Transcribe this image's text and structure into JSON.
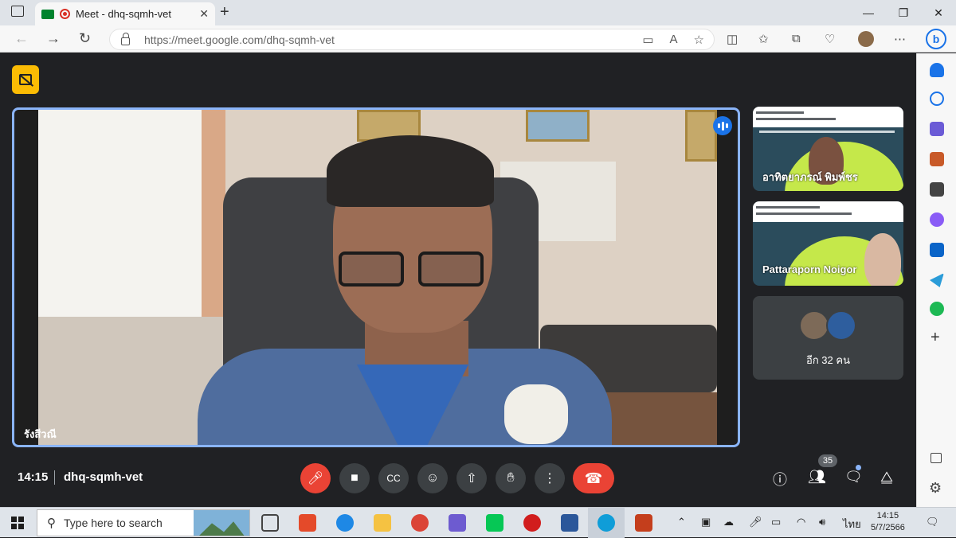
{
  "browser": {
    "tab_title": "Meet - dhq-sqmh-vet",
    "tab_close": "✕",
    "new_tab": "+",
    "win_min": "—",
    "win_max": "❐",
    "win_close": "✕",
    "url_host": "https://meet.google.com/",
    "url_path": "dhq-sqmh-vet",
    "bing": "b"
  },
  "meet": {
    "main_participant": "รังสีวณี",
    "tiles": [
      {
        "name": "อาทิตยาภรณ์ พิมพ์ชร"
      },
      {
        "name": "Pattaraporn Noigor"
      }
    ],
    "others_label": "อีก 32 คน",
    "clock": "14:15",
    "meeting_code": "dhq-sqmh-vet",
    "participants_count": "35"
  },
  "taskbar": {
    "search_placeholder": "Type here to search",
    "lang": "ไทย",
    "time": "14:15",
    "date": "5/7/2566"
  },
  "colors": {
    "accent": "#8ab4f8",
    "danger": "#ea4335",
    "present": "#fbbc04",
    "meet_bg": "#202124"
  }
}
